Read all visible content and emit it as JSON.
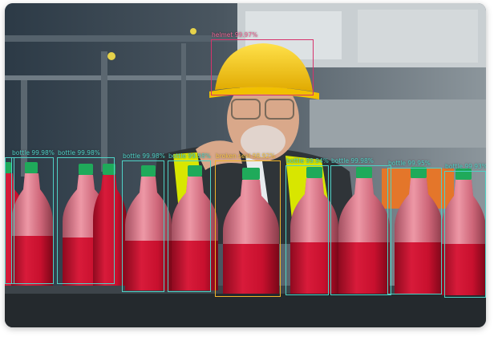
{
  "detections": [
    {
      "id": "bottle-1",
      "label": "bottle 99.98%",
      "kind": "bottle"
    },
    {
      "id": "bottle-2",
      "label": "bottle 99.98%",
      "kind": "bottle"
    },
    {
      "id": "bottle-3",
      "label": "bottle 99.98%",
      "kind": "bottle"
    },
    {
      "id": "bottle-4",
      "label": "bottle 99.98%",
      "kind": "bottle"
    },
    {
      "id": "broken-seal",
      "label": "broken seal 98.92%",
      "kind": "broken"
    },
    {
      "id": "bottle-5",
      "label": "bottle 99.94%",
      "kind": "bottle"
    },
    {
      "id": "bottle-6",
      "label": "bottle 99.98%",
      "kind": "bottle"
    },
    {
      "id": "bottle-7",
      "label": "bottle 99.95%",
      "kind": "bottle"
    },
    {
      "id": "bottle-8",
      "label": "bottle 99.93%",
      "kind": "bottle"
    },
    {
      "id": "helmet",
      "label": "helmet 99.97%",
      "kind": "helmet"
    }
  ],
  "colors": {
    "bottle_box": "#4fd1c5",
    "helmet_box": "#d6336c",
    "broken_box": "#f0b429",
    "liquid": "#c8102e",
    "cap": "#1faa5a",
    "helmet": "#f5c400",
    "vest": "#d8e600"
  }
}
